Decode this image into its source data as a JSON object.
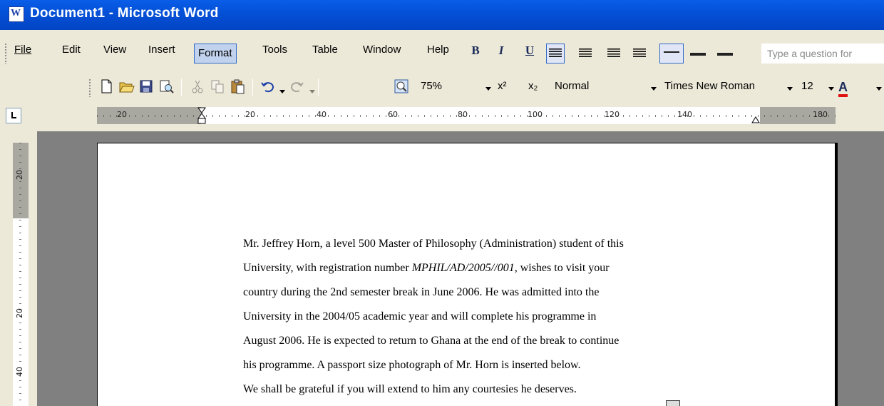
{
  "window": {
    "title": "Document1 - Microsoft Word"
  },
  "menubar": {
    "items": [
      "File",
      "Edit",
      "View",
      "Insert",
      "Format",
      "Tools",
      "Table",
      "Window",
      "Help"
    ],
    "active": "Format",
    "format_buttons": {
      "bold": "B",
      "italic": "I",
      "underline": "U"
    },
    "question_placeholder": "Type a question for"
  },
  "toolbar": {
    "zoom": "75%",
    "superscript": "x²",
    "subscript": "x₂",
    "style": "Normal",
    "font": "Times New Roman",
    "size": "12",
    "font_color_label": "A",
    "font_color": "#e01010"
  },
  "ruler": {
    "h_labels": [
      "20",
      "20",
      "40",
      "60",
      "80",
      "100",
      "120",
      "140",
      "180"
    ],
    "v_labels": [
      "20",
      "20",
      "40"
    ]
  },
  "document": {
    "lines": [
      {
        "text": "Mr. Jeffrey Horn, a level 500 Master of Philosophy (Administration) student of this"
      },
      {
        "pre": "University, with registration number ",
        "em": "MPHIL/AD/2005//001",
        "post": ", wishes to visit your"
      },
      {
        "text": "country during the 2nd semester break in June 2006. He was admitted into the"
      },
      {
        "text": "University in the 2004/05 academic year and will complete his programme in"
      },
      {
        "text": "August 2006. He is expected to return to Ghana at the end of the break to continue"
      },
      {
        "text": "his programme. A passport size photograph of Mr. Horn is inserted below."
      },
      {
        "text": "We shall be grateful if you will extend to him any courtesies he deserves."
      }
    ]
  }
}
